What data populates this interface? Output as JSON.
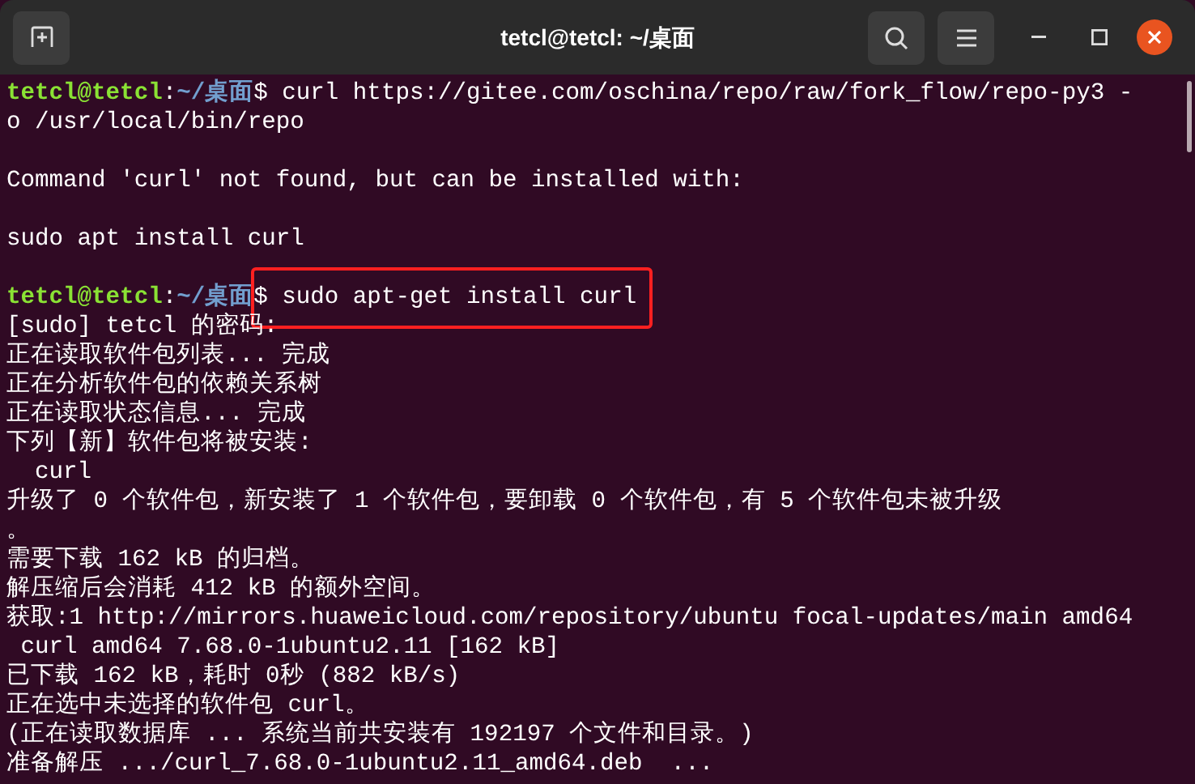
{
  "window": {
    "title": "tetcl@tetcl: ~/桌面"
  },
  "lines": [
    {
      "kind": "prompt",
      "user": "tetcl@tetcl",
      "separator": ":",
      "path": "~/桌面",
      "symbol": "$",
      "command": "curl https://gitee.com/oschina/repo/raw/fork_flow/repo-py3 -",
      "highlighted": false
    },
    {
      "kind": "output",
      "text": "o /usr/local/bin/repo"
    },
    {
      "kind": "blank"
    },
    {
      "kind": "output",
      "text": "Command 'curl' not found, but can be installed with:"
    },
    {
      "kind": "blank"
    },
    {
      "kind": "output",
      "text": "sudo apt install curl"
    },
    {
      "kind": "blank"
    },
    {
      "kind": "prompt",
      "user": "tetcl@tetcl",
      "separator": ":",
      "path": "~/桌面",
      "symbol": "$",
      "command": "sudo apt-get install curl",
      "highlighted": true
    },
    {
      "kind": "output",
      "text": "[sudo] tetcl 的密码:"
    },
    {
      "kind": "output",
      "text": "正在读取软件包列表... 完成"
    },
    {
      "kind": "output",
      "text": "正在分析软件包的依赖关系树"
    },
    {
      "kind": "output",
      "text": "正在读取状态信息... 完成"
    },
    {
      "kind": "output",
      "text": "下列【新】软件包将被安装:"
    },
    {
      "kind": "output",
      "text": "  curl"
    },
    {
      "kind": "output",
      "text": "升级了 0 个软件包，新安装了 1 个软件包，要卸载 0 个软件包，有 5 个软件包未被升级"
    },
    {
      "kind": "output",
      "text": "。"
    },
    {
      "kind": "output",
      "text": "需要下载 162 kB 的归档。"
    },
    {
      "kind": "output",
      "text": "解压缩后会消耗 412 kB 的额外空间。"
    },
    {
      "kind": "output",
      "text": "获取:1 http://mirrors.huaweicloud.com/repository/ubuntu focal-updates/main amd64"
    },
    {
      "kind": "output",
      "text": " curl amd64 7.68.0-1ubuntu2.11 [162 kB]"
    },
    {
      "kind": "output",
      "text": "已下载 162 kB，耗时 0秒 (882 kB/s)"
    },
    {
      "kind": "output",
      "text": "正在选中未选择的软件包 curl。"
    },
    {
      "kind": "output",
      "text": "(正在读取数据库 ... 系统当前共安装有 192197 个文件和目录。)"
    },
    {
      "kind": "output",
      "text": "准备解压 .../curl_7.68.0-1ubuntu2.11_amd64.deb  ..."
    }
  ]
}
